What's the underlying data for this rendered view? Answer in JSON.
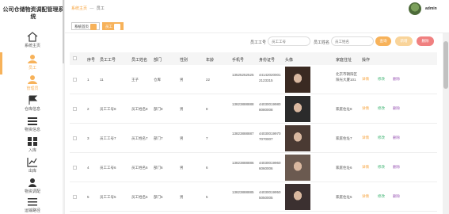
{
  "app": {
    "title": "公司仓储物资调配管理系统"
  },
  "sidebar": {
    "items": [
      {
        "label": "系统主页",
        "icon": "home-icon"
      },
      {
        "label": "员工",
        "icon": "user-icon",
        "active": true
      },
      {
        "label": "管理员",
        "icon": "admin-icon"
      },
      {
        "label": "仓库信息",
        "icon": "flag-icon"
      },
      {
        "label": "物资信息",
        "icon": "list-icon"
      },
      {
        "label": "入库",
        "icon": "grid-icon"
      },
      {
        "label": "出库",
        "icon": "chart-icon"
      },
      {
        "label": "物资调配",
        "icon": "person-icon"
      },
      {
        "label": "运输路径",
        "icon": "menu-icon"
      }
    ]
  },
  "header": {
    "breadcrumb_home": "系统主页",
    "breadcrumb_sep": "—",
    "breadcrumb_current": "员工",
    "username": "admin"
  },
  "tags": [
    {
      "label": "系统首页"
    },
    {
      "label": "员工",
      "active": true
    }
  ],
  "search": {
    "label1": "员工工号",
    "placeholder1": "员工工号",
    "label2": "员工姓名",
    "placeholder2": "员工姓名",
    "search_btn": "查询",
    "add_btn": "新增",
    "delete_btn": "删除"
  },
  "table": {
    "headers": [
      "序号",
      "员工工号",
      "员工姓名",
      "部门",
      "性别",
      "年龄",
      "手机号",
      "身份证号",
      "头像",
      "家庭住址",
      "操作"
    ],
    "actions": {
      "view": "详情",
      "edit": "修改",
      "delete": "删除"
    },
    "rows": [
      {
        "no": "1",
        "emp_no": "11",
        "name": "王子",
        "dept": "仓库",
        "gender": "男",
        "age": "22",
        "phone": "13525252525",
        "id_no": "441420200012123315",
        "address": "北京市朝阳区阳光大厦101"
      },
      {
        "no": "2",
        "emp_no": "员工工号8",
        "name": "员工姓名8",
        "dept": "部门8",
        "gender": "男",
        "age": "8",
        "phone": "13823888888",
        "id_no": "440300199808080008",
        "address": "家庭住址8"
      },
      {
        "no": "3",
        "emp_no": "员工工号7",
        "name": "员工姓名7",
        "dept": "部门7",
        "gender": "男",
        "age": "7",
        "phone": "13823888887",
        "id_no": "440300199707070007",
        "address": "家庭住址7"
      },
      {
        "no": "4",
        "emp_no": "员工工号6",
        "name": "员工姓名6",
        "dept": "部门6",
        "gender": "男",
        "age": "6",
        "phone": "13823888886",
        "id_no": "440300199606060006",
        "address": "家庭住址6"
      },
      {
        "no": "5",
        "emp_no": "员工工号5",
        "name": "员工姓名5",
        "dept": "部门5",
        "gender": "男",
        "age": "5",
        "phone": "13823888885",
        "id_no": "440300199505050005",
        "address": "家庭住址5"
      }
    ]
  },
  "colors": {
    "accent": "#f7b25a",
    "edit": "#3cb371",
    "delete": "#9b59b6",
    "danger": "#f08080"
  }
}
